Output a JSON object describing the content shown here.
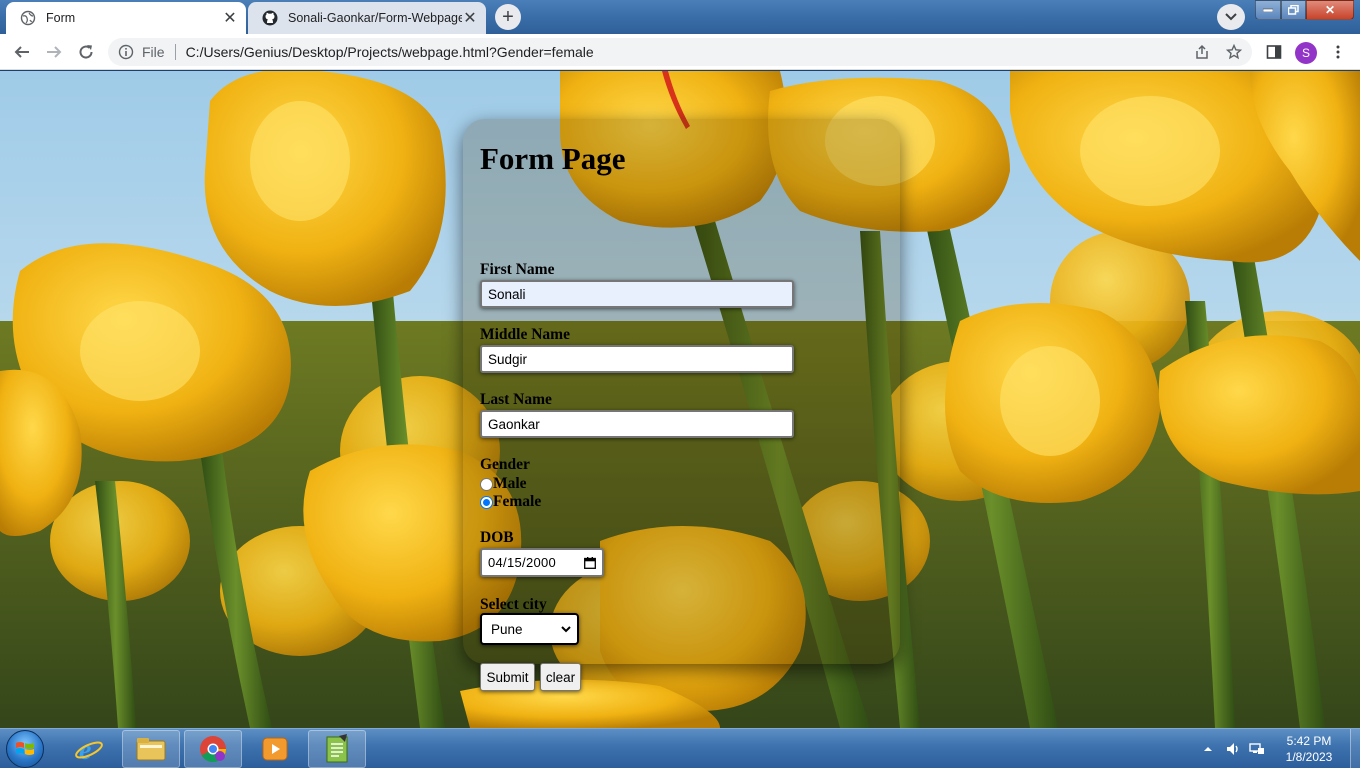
{
  "browser": {
    "tabs": [
      {
        "title": "Form",
        "favicon": "globe-icon",
        "active": true
      },
      {
        "title": "Sonali-Gaonkar/Form-Webpage",
        "favicon": "github-icon",
        "active": false
      }
    ],
    "address": {
      "scheme_label": "File",
      "url": "C:/Users/Genius/Desktop/Projects/webpage.html?Gender=female"
    },
    "profile_initial": "S"
  },
  "form": {
    "title": "Form Page",
    "first_name_label": "First Name",
    "first_name_value": "Sonali",
    "middle_name_label": "Middle Name",
    "middle_name_value": "Sudgir",
    "last_name_label": "Last Name",
    "last_name_value": "Gaonkar",
    "gender_label": "Gender",
    "gender_options": [
      "Male",
      "Female"
    ],
    "gender_selected": "Female",
    "dob_label": "DOB",
    "dob_value": "04/15/2000",
    "city_label": "Select city",
    "city_value": "Pune",
    "submit_label": "Submit",
    "clear_label": "clear"
  },
  "taskbar": {
    "time": "5:42 PM",
    "date": "1/8/2023"
  },
  "colors": {
    "radio_accent": "#0075ff",
    "profile_bg": "#9334c9",
    "autofill_bg": "#e8f0fe"
  }
}
